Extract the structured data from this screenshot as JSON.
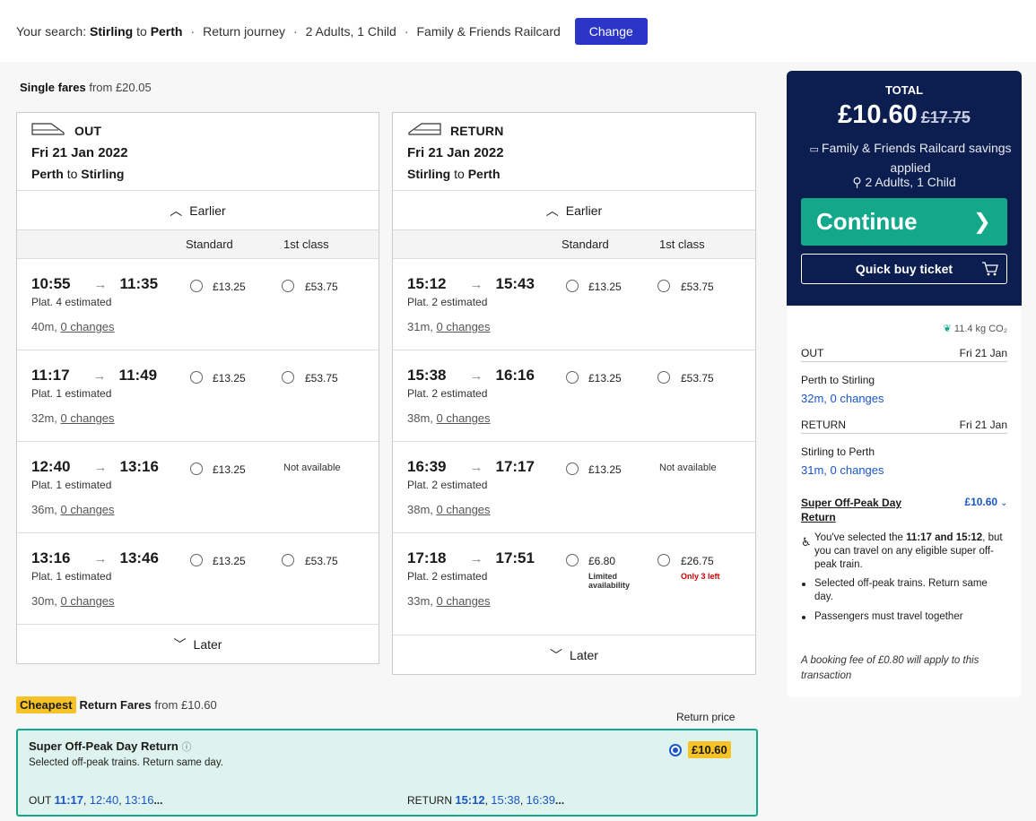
{
  "search": {
    "prefix": "Your search:",
    "from": "Stirling",
    "to_word": "to",
    "to": "Perth",
    "journey": "Return journey",
    "passengers": "2 Adults, 1 Child",
    "railcard": "Family & Friends Railcard",
    "change": "Change"
  },
  "single": {
    "title": "Single fares",
    "from_text": "from £20.05"
  },
  "columns": {
    "standard": "Standard",
    "first": "1st class"
  },
  "out": {
    "label": "OUT",
    "date": "Fri 21 Jan 2022",
    "from": "Perth",
    "to_word": "to",
    "to": "Stirling",
    "earlier": "Earlier",
    "later": "Later",
    "rows": [
      {
        "dep": "10:55",
        "arr": "11:35",
        "plat": "Plat. 4 estimated",
        "dur": "40m,",
        "changes": "0 changes",
        "std": "£13.25",
        "first": "£53.75"
      },
      {
        "dep": "11:17",
        "arr": "11:49",
        "plat": "Plat. 1 estimated",
        "dur": "32m,",
        "changes": "0 changes",
        "std": "£13.25",
        "first": "£53.75"
      },
      {
        "dep": "12:40",
        "arr": "13:16",
        "plat": "Plat. 1 estimated",
        "dur": "36m,",
        "changes": "0 changes",
        "std": "£13.25",
        "first": "Not available"
      },
      {
        "dep": "13:16",
        "arr": "13:46",
        "plat": "Plat. 1 estimated",
        "dur": "30m,",
        "changes": "0 changes",
        "std": "£13.25",
        "first": "£53.75"
      }
    ]
  },
  "ret": {
    "label": "RETURN",
    "date": "Fri 21 Jan 2022",
    "from": "Stirling",
    "to_word": "to",
    "to": "Perth",
    "earlier": "Earlier",
    "later": "Later",
    "rows": [
      {
        "dep": "15:12",
        "arr": "15:43",
        "plat": "Plat. 2 estimated",
        "dur": "31m,",
        "changes": "0 changes",
        "std": "£13.25",
        "first": "£53.75"
      },
      {
        "dep": "15:38",
        "arr": "16:16",
        "plat": "Plat. 2 estimated",
        "dur": "38m,",
        "changes": "0 changes",
        "std": "£13.25",
        "first": "£53.75"
      },
      {
        "dep": "16:39",
        "arr": "17:17",
        "plat": "Plat. 2 estimated",
        "dur": "38m,",
        "changes": "0 changes",
        "std": "£13.25",
        "first": "Not available"
      },
      {
        "dep": "17:18",
        "arr": "17:51",
        "plat": "Plat. 2 estimated",
        "dur": "33m,",
        "changes": "0 changes",
        "std": "£6.80",
        "std_note": "Limited availability",
        "first": "£26.75",
        "first_note": "Only 3 left"
      }
    ]
  },
  "total": {
    "label": "TOTAL",
    "amount": "£10.60",
    "old": "£17.75",
    "railcard": "Family & Friends Railcard savings applied",
    "pax": "2 Adults, 1 Child",
    "continue": "Continue",
    "quick": "Quick buy ticket"
  },
  "summary": {
    "co2": "11.4 kg CO₂",
    "out_label": "OUT",
    "out_date": "Fri 21 Jan",
    "out_route": "Perth to Stirling",
    "out_detail": "32m, 0 changes",
    "ret_label": "RETURN",
    "ret_date": "Fri 21 Jan",
    "ret_route": "Stirling to Perth",
    "ret_detail": "31m, 0 changes",
    "fare_name": "Super Off-Peak Day Return",
    "fare_price": "£10.60",
    "sel_a": "You've selected the ",
    "sel_t1": "11:17",
    "sel_and": " and ",
    "sel_t2": "15:12",
    "sel_b": ", but you can travel on any eligible super off-peak train.",
    "b1": "Selected off-peak trains. Return same day.",
    "b2": "Passengers must travel together",
    "fee": "A booking fee of £0.80 will apply to this transaction"
  },
  "cheapest": {
    "tag": "Cheapest",
    "title": "Return Fares",
    "from_text": "from £10.60",
    "return_price": "Return price",
    "fare_name": "Super Off-Peak Day Return",
    "fare_desc": "Selected off-peak trains. Return same day.",
    "price": "£10.60",
    "out_label": "OUT",
    "out_times": [
      "11:17",
      "12:40",
      "13:16"
    ],
    "ret_label": "RETURN",
    "ret_times": [
      "15:12",
      "15:38",
      "16:39"
    ]
  },
  "colors": {
    "brand": "#2b35c6",
    "navy": "#0b1e4f",
    "teal": "#14a88b",
    "highlight": "#f7c226",
    "link": "#1a56c7"
  }
}
